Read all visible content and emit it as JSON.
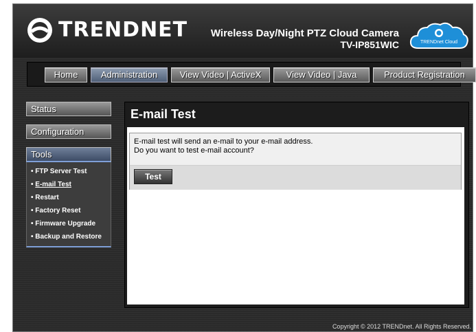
{
  "header": {
    "brand": "TRENDNET",
    "product_line": "Wireless Day/Night PTZ Cloud Camera",
    "model": "TV-IP851WIC",
    "cloud_badge": "TRENDnet Cloud"
  },
  "nav": {
    "home": "Home",
    "administration": "Administration",
    "view_video_activex": "View Video | ActiveX",
    "view_video_java": "View Video | Java",
    "product_registration": "Product Registration"
  },
  "sidebar": {
    "status": "Status",
    "configuration": "Configuration",
    "tools": "Tools",
    "tool_items": [
      "FTP Server Test",
      "E-mail Test",
      "Restart",
      "Factory Reset",
      "Firmware Upgrade",
      "Backup and Restore"
    ]
  },
  "main": {
    "title": "E-mail Test",
    "line1": "E-mail test will send an e-mail to your e-mail address.",
    "line2": "Do you want to test e-mail account?",
    "test_button": "Test"
  },
  "footer": "Copyright © 2012 TRENDnet.  All Rights Reserved.",
  "colors": {
    "background": "#2a2a2a",
    "accent": "#7fa0d8",
    "cloud": "#1e8fd8"
  }
}
